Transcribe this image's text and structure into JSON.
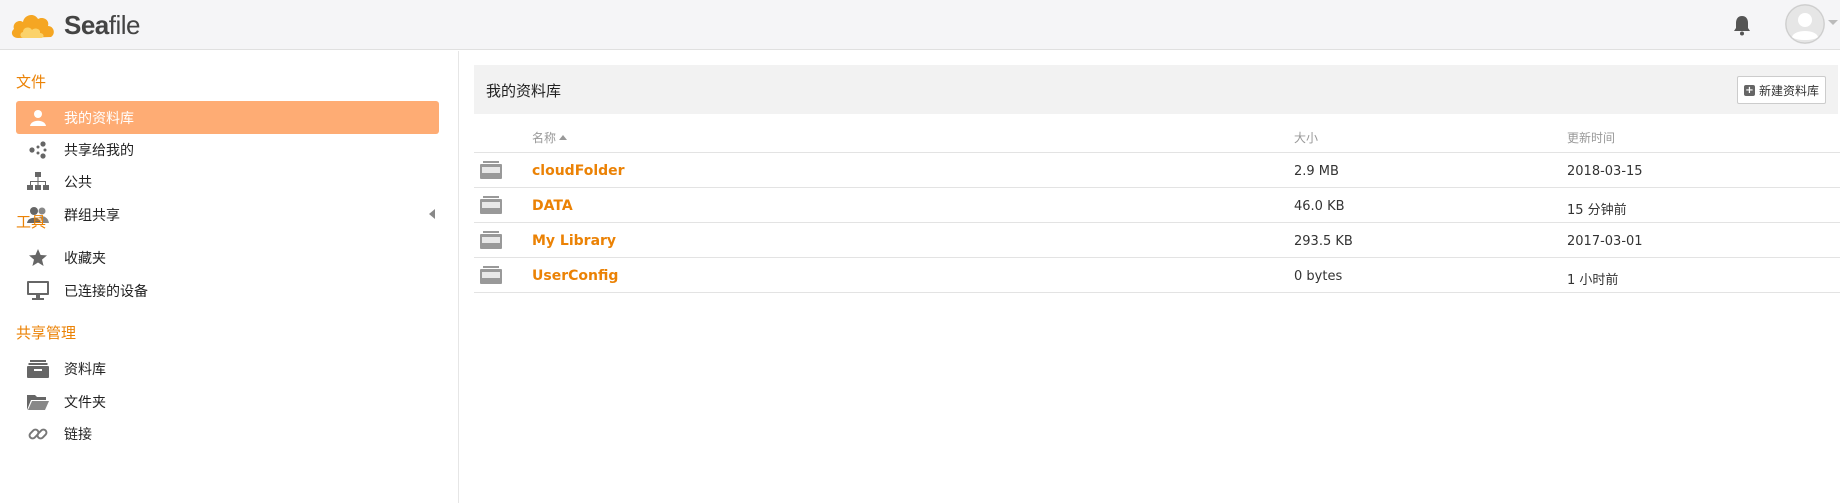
{
  "header": {
    "logo_text_bold": "Sea",
    "logo_text_rest": "file",
    "accent": "#eb8205"
  },
  "sidebar": {
    "section_files": "文件",
    "section_tools": "工具",
    "section_share_admin": "共享管理",
    "items": [
      {
        "label": "我的资料库",
        "icon": "user-icon",
        "active": true
      },
      {
        "label": "共享给我的",
        "icon": "share-icon"
      },
      {
        "label": "公共",
        "icon": "org-chart-icon"
      },
      {
        "label": "群组共享",
        "icon": "group-icon"
      },
      {
        "label": "收藏夹",
        "icon": "star-icon"
      },
      {
        "label": "已连接的设备",
        "icon": "monitor-icon"
      },
      {
        "label": "资料库",
        "icon": "library-stack-icon"
      },
      {
        "label": "文件夹",
        "icon": "folder-open-icon"
      },
      {
        "label": "链接",
        "icon": "link-icon"
      }
    ]
  },
  "main": {
    "title": "我的资料库",
    "new_library_label": "新建资料库",
    "columns": {
      "name": "名称",
      "size": "大小",
      "updated": "更新时间"
    },
    "rows": [
      {
        "name": "cloudFolder",
        "size": "2.9 MB",
        "updated": "2018-03-15"
      },
      {
        "name": "DATA",
        "size": "46.0 KB",
        "updated": "15 分钟前"
      },
      {
        "name": "My Library",
        "size": "293.5 KB",
        "updated": "2017-03-01"
      },
      {
        "name": "UserConfig",
        "size": "0 bytes",
        "updated": "1 小时前"
      }
    ]
  }
}
